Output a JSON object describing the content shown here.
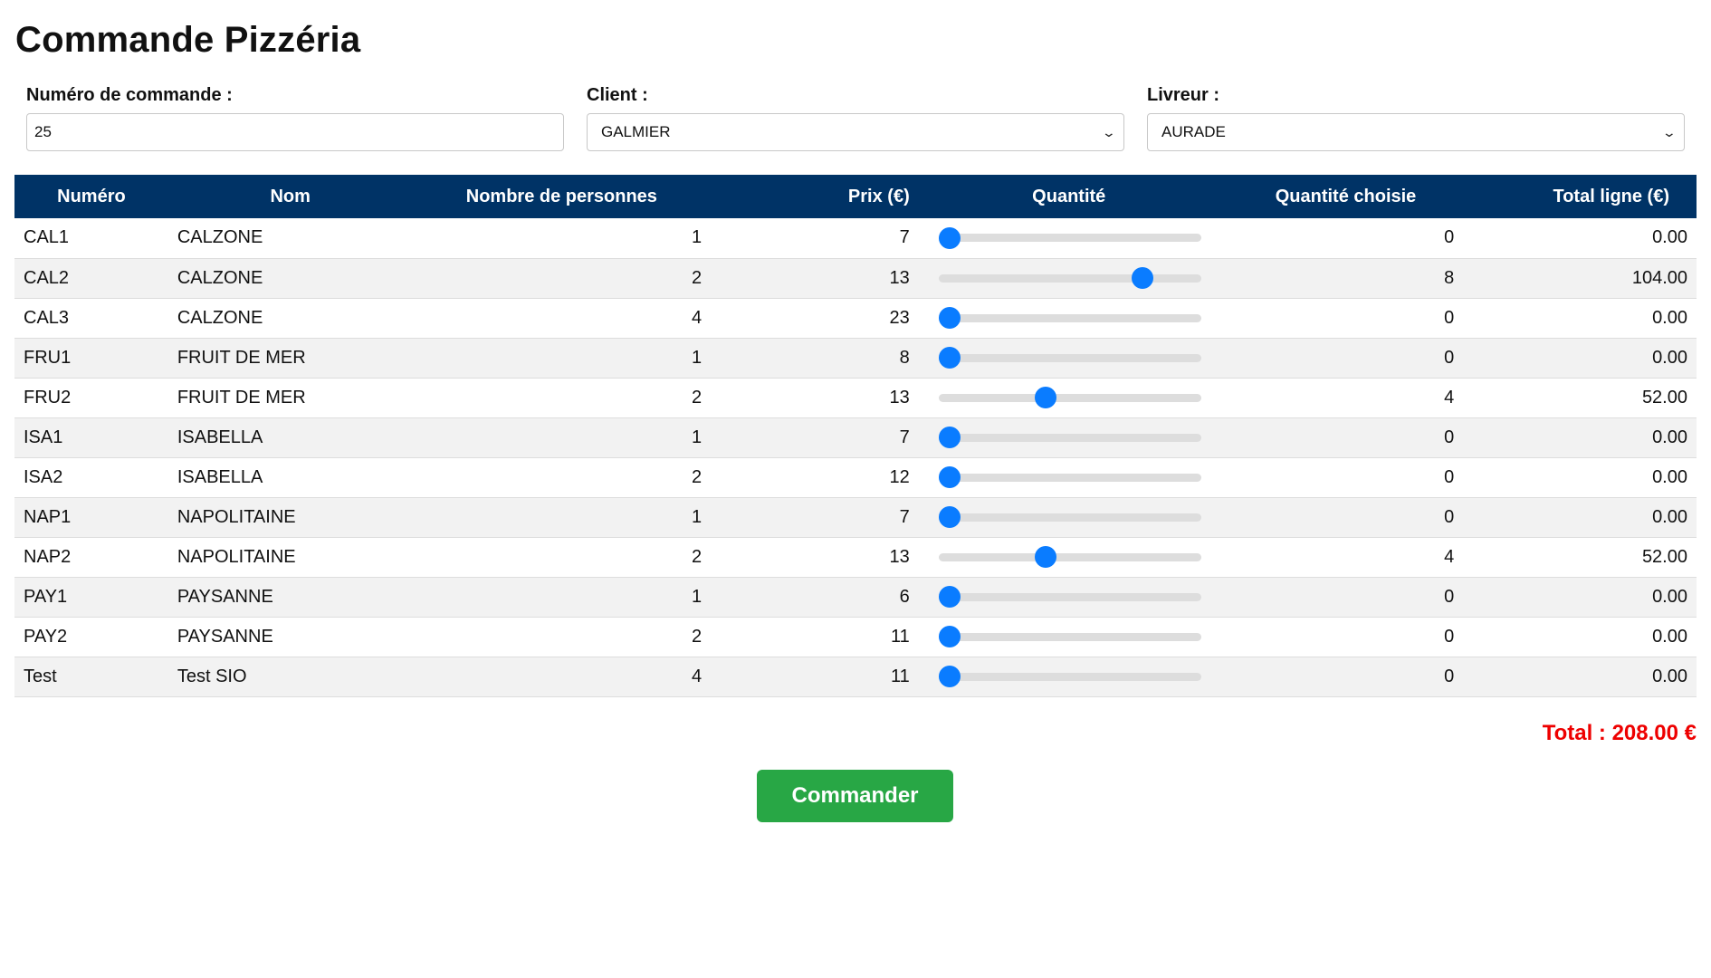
{
  "header": {
    "title": "Commande Pizzéria"
  },
  "form": {
    "order_number": {
      "label": "Numéro de commande :",
      "value": "25"
    },
    "client": {
      "label": "Client :",
      "selected": "GALMIER"
    },
    "livreur": {
      "label": "Livreur :",
      "selected": "AURADE"
    }
  },
  "table": {
    "columns": [
      "Numéro",
      "Nom",
      "Nombre de personnes",
      "Prix (€)",
      "Quantité",
      "Quantité choisie",
      "Total ligne (€)"
    ],
    "slider_max": 10,
    "rows": [
      {
        "numero": "CAL1",
        "nom": "CALZONE",
        "personnes": "1",
        "prix": "7",
        "quantite": 0,
        "choisie": "0",
        "total": "0.00"
      },
      {
        "numero": "CAL2",
        "nom": "CALZONE",
        "personnes": "2",
        "prix": "13",
        "quantite": 8,
        "choisie": "8",
        "total": "104.00"
      },
      {
        "numero": "CAL3",
        "nom": "CALZONE",
        "personnes": "4",
        "prix": "23",
        "quantite": 0,
        "choisie": "0",
        "total": "0.00"
      },
      {
        "numero": "FRU1",
        "nom": "FRUIT DE MER",
        "personnes": "1",
        "prix": "8",
        "quantite": 0,
        "choisie": "0",
        "total": "0.00"
      },
      {
        "numero": "FRU2",
        "nom": "FRUIT DE MER",
        "personnes": "2",
        "prix": "13",
        "quantite": 4,
        "choisie": "4",
        "total": "52.00"
      },
      {
        "numero": "ISA1",
        "nom": "ISABELLA",
        "personnes": "1",
        "prix": "7",
        "quantite": 0,
        "choisie": "0",
        "total": "0.00"
      },
      {
        "numero": "ISA2",
        "nom": "ISABELLA",
        "personnes": "2",
        "prix": "12",
        "quantite": 0,
        "choisie": "0",
        "total": "0.00"
      },
      {
        "numero": "NAP1",
        "nom": "NAPOLITAINE",
        "personnes": "1",
        "prix": "7",
        "quantite": 0,
        "choisie": "0",
        "total": "0.00"
      },
      {
        "numero": "NAP2",
        "nom": "NAPOLITAINE",
        "personnes": "2",
        "prix": "13",
        "quantite": 4,
        "choisie": "4",
        "total": "52.00"
      },
      {
        "numero": "PAY1",
        "nom": "PAYSANNE",
        "personnes": "1",
        "prix": "6",
        "quantite": 0,
        "choisie": "0",
        "total": "0.00"
      },
      {
        "numero": "PAY2",
        "nom": "PAYSANNE",
        "personnes": "2",
        "prix": "11",
        "quantite": 0,
        "choisie": "0",
        "total": "0.00"
      },
      {
        "numero": "Test",
        "nom": "Test SIO",
        "personnes": "4",
        "prix": "11",
        "quantite": 0,
        "choisie": "0",
        "total": "0.00"
      }
    ]
  },
  "summary": {
    "total": "Total : 208.00 €"
  },
  "actions": {
    "order_button": "Commander"
  },
  "colors": {
    "header_bg": "#003366",
    "slider_thumb": "#0a7cff",
    "total_text": "#ee0000",
    "button_bg": "#28a745"
  }
}
